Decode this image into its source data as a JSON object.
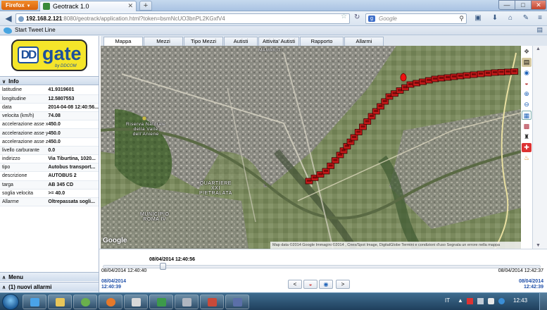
{
  "browser": {
    "menu_label": "Firefox",
    "tab_title": "Geotrack 1.0",
    "url_host": "192.168.2.121",
    "url_path": ":8080/geotrack/application.html?token=bsmNcUO3bnPL2KGxfV4",
    "search_placeholder": "Google",
    "bookmark_label": "Start Tweet Line"
  },
  "logo": {
    "mark": "DD",
    "name": "gate",
    "byline": "by DDCOM"
  },
  "sidebar": {
    "info_title": "Info",
    "info_rows": [
      {
        "key": "latitudine",
        "value": "41.9319601"
      },
      {
        "key": "longitudine",
        "value": "12.5807553"
      },
      {
        "key": "data",
        "value": "2014-04-08 12:40:56..."
      },
      {
        "key": "velocita (km/h)",
        "value": "74.08"
      },
      {
        "key": "accelerazione asse x",
        "value": "450.0"
      },
      {
        "key": "accelerazione asse y",
        "value": "450.0"
      },
      {
        "key": "accelerazione asse z",
        "value": "450.0"
      },
      {
        "key": "livello carburante",
        "value": "0.0"
      },
      {
        "key": "indirizzo",
        "value": "Via Tiburtina, 1020..."
      },
      {
        "key": "tipo",
        "value": "Autobus transport..."
      },
      {
        "key": "descrizione",
        "value": "AUTOBUS 2"
      },
      {
        "key": "targa",
        "value": "AB 345 CD"
      },
      {
        "key": "soglia velocita",
        "value": ">= 40.0"
      },
      {
        "key": "Allarme",
        "value": "Oltrepassata sogli..."
      }
    ],
    "menu_title": "Menu",
    "alarms_title": "(1) nuovi allarmi"
  },
  "tabs": [
    {
      "label": "Mappa",
      "active": true
    },
    {
      "label": "Mezzi",
      "active": false
    },
    {
      "label": "Tipo Mezzi",
      "active": false
    },
    {
      "label": "Autisti",
      "active": false
    },
    {
      "label": "Attivita' Autisti",
      "active": false
    },
    {
      "label": "Rapporto giornaliero",
      "active": false
    },
    {
      "label": "Allarmi",
      "active": false
    }
  ],
  "map": {
    "labels": {
      "mammut": "MAMMUT",
      "riserva": "Riserva Naturale\ndella Valle\ndell'Aniene",
      "quartiere": "QUARTIERE\nXXI\nPIETRALATA",
      "municipio": "MUNICIPIO\nROMA IV"
    },
    "google": "Google",
    "attribution": "Map data ©2014 Google Immagini ©2014 , Cnes/Spot Image, DigitalGlobe   Termini e condizioni d'uso   Segnala un errore nella mappa",
    "route_color": "#c61a1a",
    "tools": [
      "layers-icon",
      "print-icon",
      "globe-icon",
      "car-icon",
      "zoom-in-icon",
      "zoom-out-icon",
      "report-icon",
      "bus-icon",
      "walk-icon",
      "alert-icon",
      "fire-icon"
    ]
  },
  "timeline": {
    "current": "08/04/2014 12:40:56",
    "start": "08/04/2014 12:40:40",
    "end": "08/04/2014 12:42:37",
    "range_start": "08/04/2014\n12:40:39",
    "range_end": "08/04/2014\n12:42:39",
    "position": 0.137,
    "prev_label": "<",
    "next_label": ">"
  },
  "taskbar": {
    "lang": "IT",
    "time": "12:43"
  }
}
